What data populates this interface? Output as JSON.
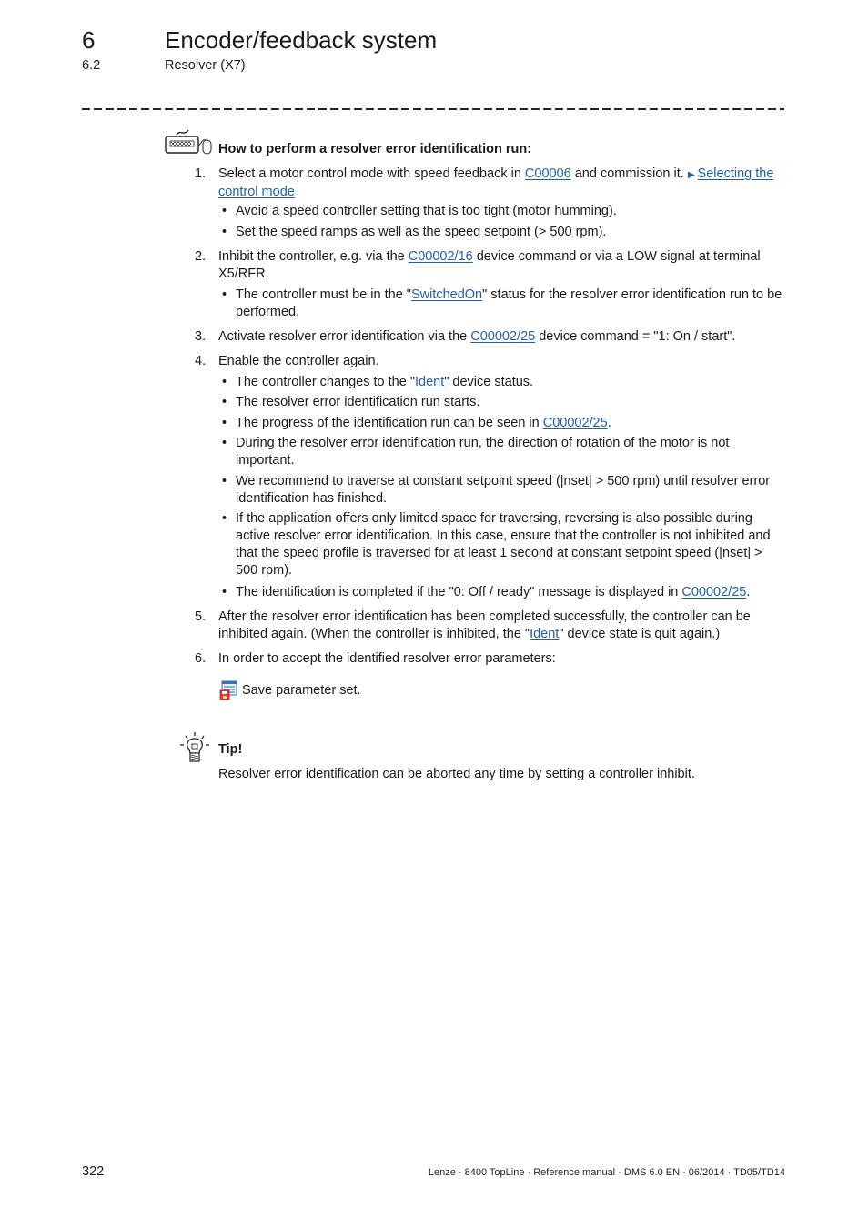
{
  "header": {
    "chapter_number": "6",
    "chapter_title": "Encoder/feedback system",
    "section_number": "6.2",
    "section_title": "Resolver (X7)"
  },
  "icons": {
    "howto": "keyboard-mouse-icon",
    "save": "save-parameter-set-icon",
    "tip": "lightbulb-icon",
    "link_arrow": "triangle-right-icon"
  },
  "colors": {
    "link": "#1f5fa8",
    "text": "#1a1a1a"
  },
  "howto_title": "How to perform a resolver error identification run:",
  "steps": [
    {
      "number": "1.",
      "text_before": "Select a motor control mode with speed feedback in ",
      "link1": "C00006",
      "text_mid": " and commission it. ",
      "arrow": "▶",
      "link2": "Selecting the control mode",
      "bullets": [
        "Avoid a speed controller setting that is too tight (motor humming).",
        "Set the speed ramps as well as the speed setpoint (> 500 rpm)."
      ]
    },
    {
      "number": "2.",
      "text_before": "Inhibit the controller, e.g. via the ",
      "link1": "C00002/16",
      "text_after": " device command or via a LOW signal at terminal X5/RFR.",
      "bullet": {
        "before": "The controller must be in the \"",
        "link": "SwitchedOn",
        "after": "\" status for the resolver error identification run to be performed."
      }
    },
    {
      "number": "3.",
      "text_before": "Activate resolver error identification via the ",
      "link1": "C00002/25",
      "text_after": " device command = \"1: On / start\"."
    },
    {
      "number": "4.",
      "text": "Enable the controller again.",
      "bullets": [
        {
          "before": "The controller changes to the \"",
          "link": "Ident",
          "after": "\" device status."
        },
        {
          "text": "The resolver error identification run starts."
        },
        {
          "before": "The progress of the identification run can be seen in ",
          "link": "C00002/25",
          "after": "."
        },
        {
          "text": "During the resolver error identification run, the direction of rotation of the motor is not important."
        },
        {
          "text": "We recommend to traverse at constant setpoint speed (|nset| > 500 rpm) until resolver error identification has finished."
        },
        {
          "text": "If the application offers only limited space for traversing, reversing is also possible during active resolver error identification. In this case, ensure that the controller is not inhibited and that the speed profile is traversed for at least 1 second at constant setpoint speed (|nset| > 500 rpm)."
        },
        {
          "before": "The identification is completed if the \"0: Off / ready\" message is displayed in ",
          "link": "C00002/25",
          "after": "."
        }
      ]
    },
    {
      "number": "5.",
      "text_before": "After the resolver error identification has been completed successfully, the controller can be inhibited again. (When the controller is inhibited, the \"",
      "link1": "Ident",
      "text_after": "\" device state is quit again.)"
    },
    {
      "number": "6.",
      "text": "In order to accept the identified resolver error parameters:",
      "action_label": "Save parameter set."
    }
  ],
  "bullet_char": "•",
  "tip": {
    "title": "Tip!",
    "text": "Resolver error identification can be aborted any time by setting a controller inhibit."
  },
  "footer": {
    "page_number": "322",
    "meta": "Lenze · 8400 TopLine · Reference manual · DMS 6.0 EN · 06/2014 · TD05/TD14"
  }
}
